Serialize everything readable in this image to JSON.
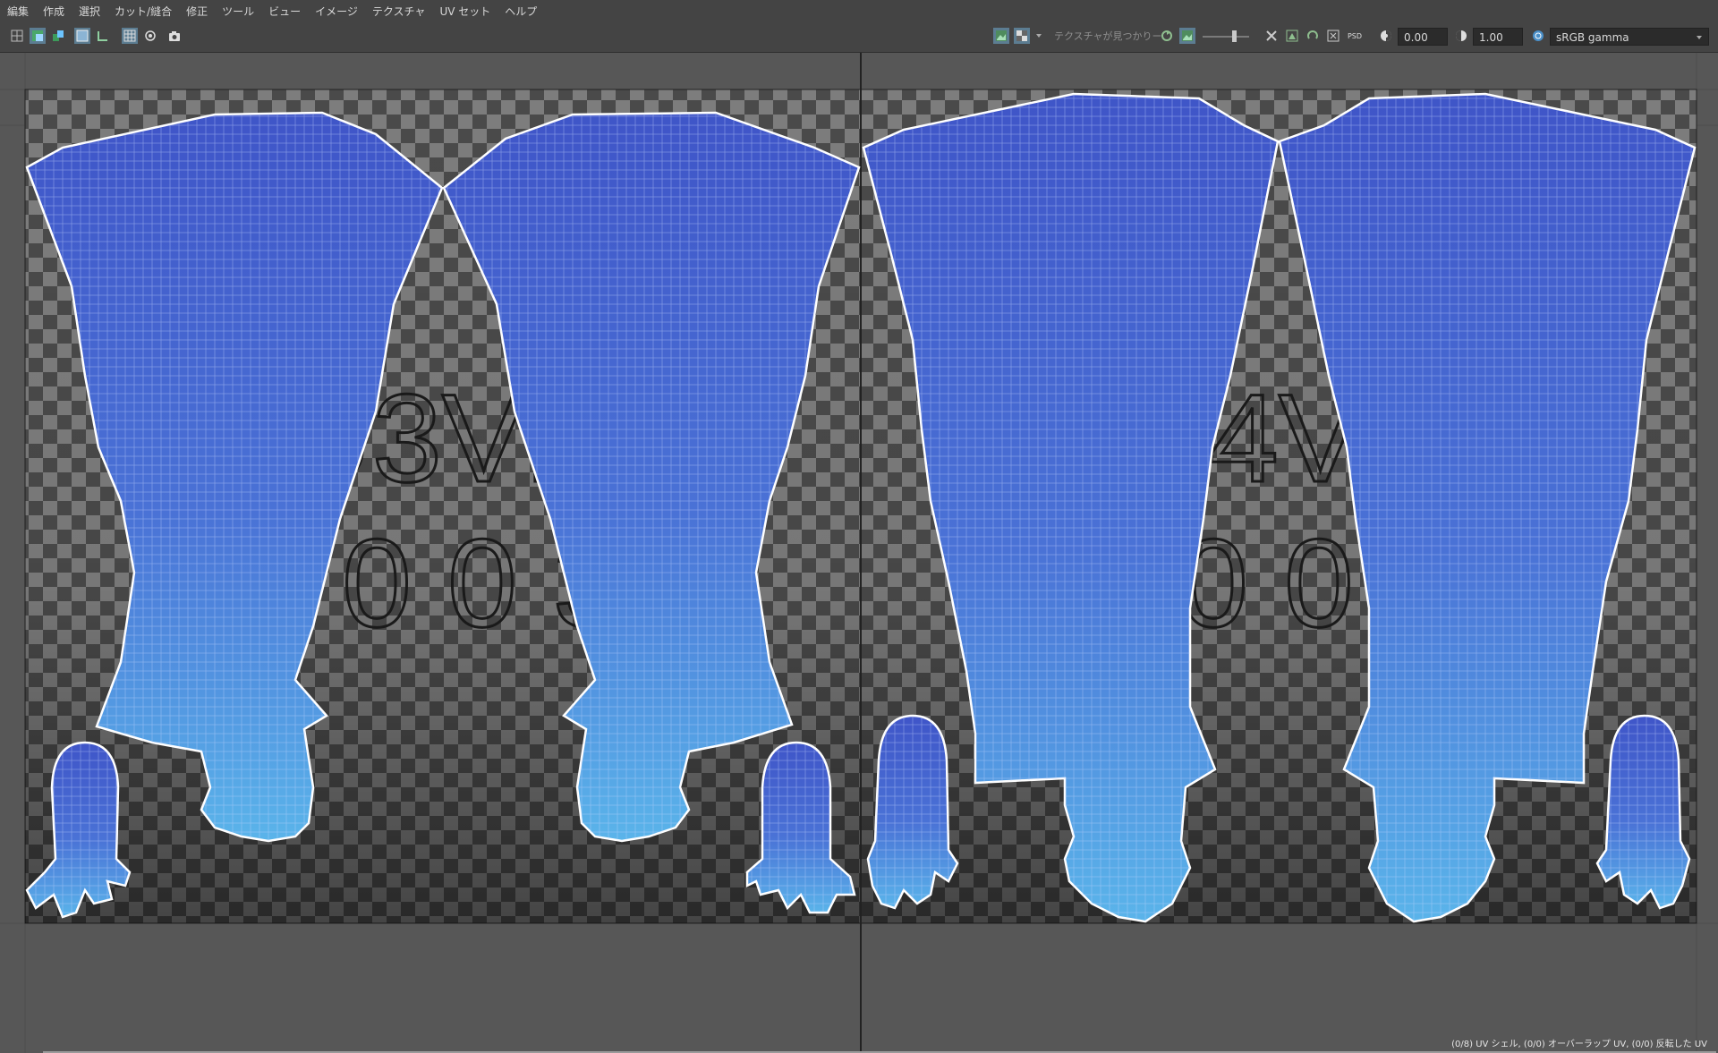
{
  "menubar": {
    "items": [
      "編集",
      "作成",
      "選択",
      "カット/縫合",
      "修正",
      "ツール",
      "ビュー",
      "イメージ",
      "テクスチャ",
      "UV セット",
      "ヘルプ"
    ]
  },
  "toolbar": {
    "texture_status": "テクスチャが見つかりー",
    "exposure_value": "0.00",
    "gamma_value": "1.00",
    "color_space": "sRGB gamma",
    "psd_label": "PSD"
  },
  "tiles": [
    {
      "line1": "U3V1",
      "line2": "1003"
    },
    {
      "line1": "U4V1",
      "line2": "1004"
    }
  ],
  "status": {
    "text": "(0/8) UV シェル, (0/0) オーバーラップ UV, (0/0) 反転した UV"
  },
  "colors": {
    "ui_background": "#444444",
    "viewport_background": "#575757",
    "uv_fill_top": "#3f55c8",
    "uv_fill_bottom": "#5ab4ea",
    "uv_border": "#ffffff",
    "tile_label_stroke": "#1a1a1a"
  }
}
